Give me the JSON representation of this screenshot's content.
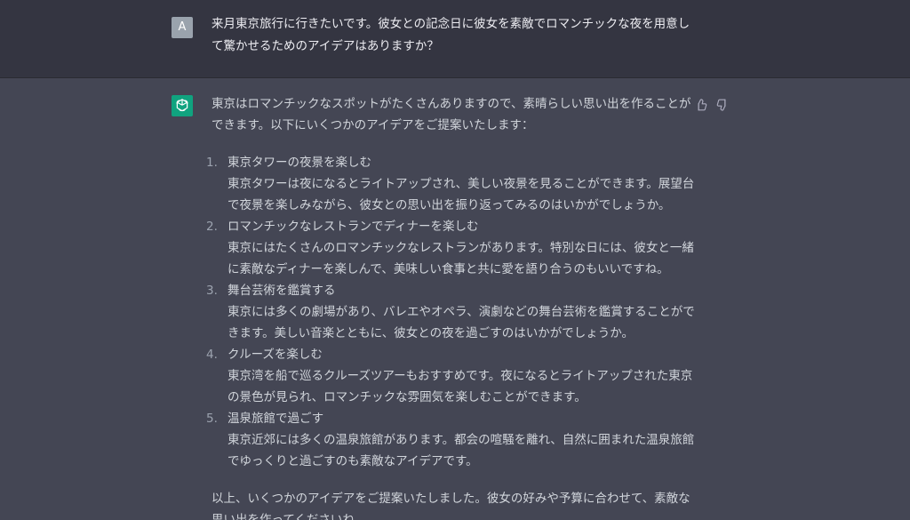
{
  "user": {
    "avatar_letter": "A",
    "message": "来月東京旅行に行きたいです。彼女との記念日に彼女を素敵でロマンチックな夜を用意して驚かせるためのアイデアはありますか？"
  },
  "assistant": {
    "intro": "東京はロマンチックなスポットがたくさんありますので、素晴らしい思い出を作ることができます。以下にいくつかのアイデアをご提案いたします：",
    "ideas": [
      {
        "num": "1.",
        "title": "東京タワーの夜景を楽しむ",
        "body": "東京タワーは夜になるとライトアップされ、美しい夜景を見ることができます。展望台で夜景を楽しみながら、彼女との思い出を振り返ってみるのはいかがでしょうか。"
      },
      {
        "num": "2.",
        "title": "ロマンチックなレストランでディナーを楽しむ",
        "body": "東京にはたくさんのロマンチックなレストランがあります。特別な日には、彼女と一緒に素敵なディナーを楽しんで、美味しい食事と共に愛を語り合うのもいいですね。"
      },
      {
        "num": "3.",
        "title": "舞台芸術を鑑賞する",
        "body": "東京には多くの劇場があり、バレエやオペラ、演劇などの舞台芸術を鑑賞することができます。美しい音楽とともに、彼女との夜を過ごすのはいかがでしょうか。"
      },
      {
        "num": "4.",
        "title": "クルーズを楽しむ",
        "body": "東京湾を船で巡るクルーズツアーもおすすめです。夜になるとライトアップされた東京の景色が見られ、ロマンチックな雰囲気を楽しむことができます。"
      },
      {
        "num": "5.",
        "title": "温泉旅館で過ごす",
        "body": "東京近郊には多くの温泉旅館があります。都会の喧騒を離れ、自然に囲まれた温泉旅館でゆっくりと過ごすのも素敵なアイデアです。"
      }
    ],
    "outro": "以上、いくつかのアイデアをご提案いたしました。彼女の好みや予算に合わせて、素敵な思い出を作ってくださいね。"
  },
  "icons": {
    "assistant_avatar": "openai-logo-icon",
    "thumbs_up": "thumbs-up-icon",
    "thumbs_down": "thumbs-down-icon"
  },
  "colors": {
    "user_bg": "#343541",
    "assistant_bg": "#444654",
    "avatar_user": "#9aa3ad",
    "avatar_assistant": "#10a37f"
  }
}
